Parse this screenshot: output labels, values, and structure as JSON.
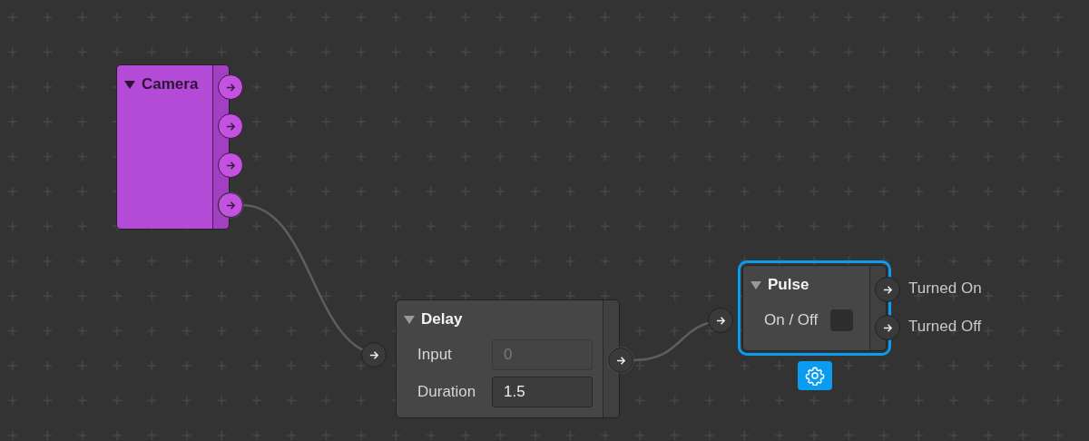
{
  "nodes": [
    {
      "title": "Camera",
      "kind": "camera",
      "color": "#b44bd6",
      "expanded": true,
      "selected": false,
      "outputs": [
        {
          "connected": false
        },
        {
          "connected": false
        },
        {
          "connected": false
        },
        {
          "connected": true
        }
      ]
    },
    {
      "title": "Delay",
      "kind": "logic",
      "color": "#464646",
      "expanded": true,
      "selected": false,
      "rows": [
        {
          "kind": "field",
          "label": "Input",
          "value": "0",
          "disabled": true,
          "port": true
        },
        {
          "kind": "field",
          "label": "Duration",
          "value": "1.5",
          "disabled": false,
          "port": false
        }
      ],
      "outputs": [
        {
          "connected": true
        }
      ]
    },
    {
      "title": "Pulse",
      "kind": "logic",
      "color": "#464646",
      "expanded": true,
      "selected": true,
      "rows": [
        {
          "kind": "checkbox",
          "label": "On / Off",
          "checked": false,
          "port": true
        }
      ],
      "outputs": [
        {
          "label": "Turned On",
          "connected": false
        },
        {
          "label": "Turned Off",
          "connected": false
        }
      ]
    }
  ]
}
